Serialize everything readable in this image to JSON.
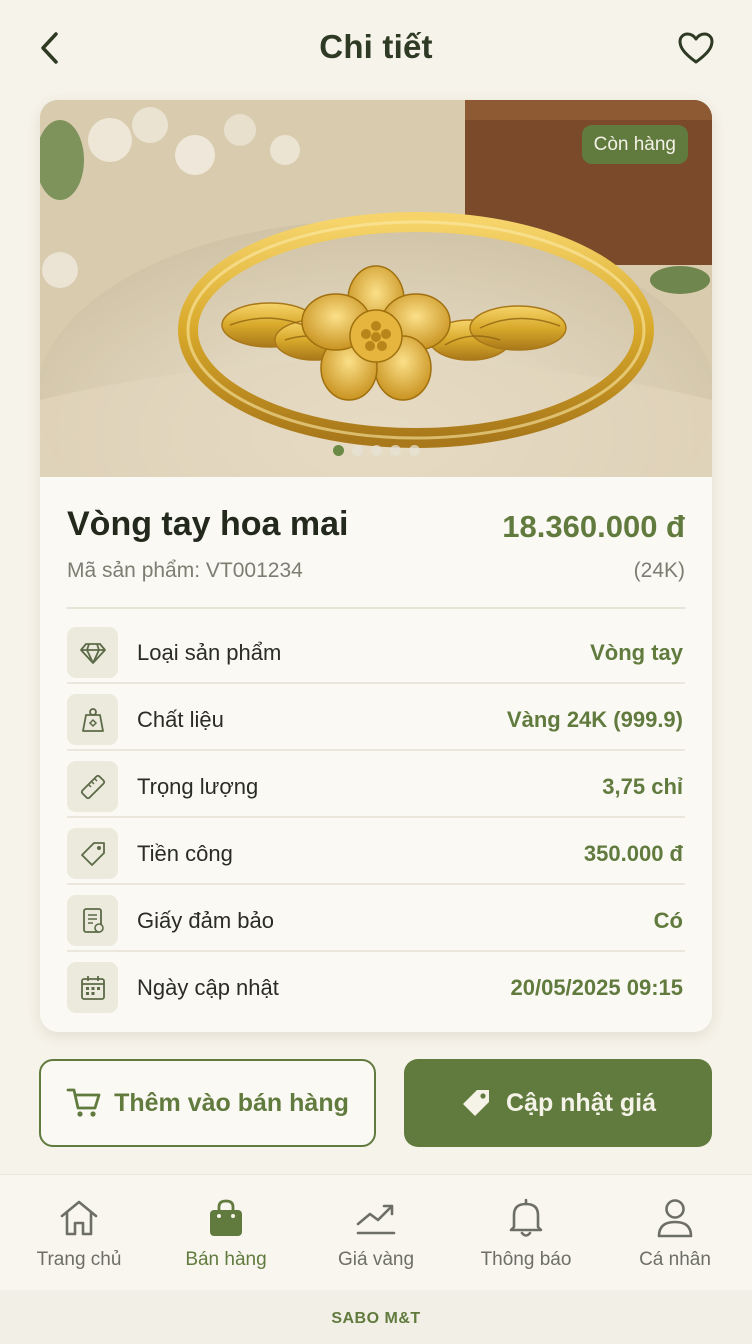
{
  "header": {
    "title": "Chi tiết",
    "back_icon": "chevron-left-icon",
    "favorite_icon": "heart-icon"
  },
  "product": {
    "stock_badge": "Còn hàng",
    "name": "Vòng tay hoa mai",
    "price": "18.360.000 đ",
    "code": "Mã sản phẩm: VT001234",
    "karat": "(24K)",
    "image_count": 5,
    "active_image": 1
  },
  "specs": [
    {
      "icon": "diamond-icon",
      "label": "Loại sản phẩm",
      "value": "Vòng tay"
    },
    {
      "icon": "weight-icon",
      "label": "Chất liệu",
      "value": "Vàng 24K (999.9)"
    },
    {
      "icon": "ruler-icon",
      "label": "Trọng lượng",
      "value": "3,75 chỉ"
    },
    {
      "icon": "tag-icon",
      "label": "Tiền công",
      "value": "350.000 đ"
    },
    {
      "icon": "certificate-icon",
      "label": "Giấy đảm bảo",
      "value": "Có"
    },
    {
      "icon": "calendar-icon",
      "label": "Ngày cập nhật",
      "value": "20/05/2025 09:15"
    }
  ],
  "actions": {
    "add_label": "Thêm vào bán hàng",
    "update_label": "Cập nhật giá"
  },
  "nav": [
    {
      "icon": "home-icon",
      "label": "Trang chủ",
      "active": false
    },
    {
      "icon": "shopping-bag-icon",
      "label": "Bán hàng",
      "active": true
    },
    {
      "icon": "trend-chart-icon",
      "label": "Giá vàng",
      "active": false
    },
    {
      "icon": "bell-icon",
      "label": "Thông báo",
      "active": false
    },
    {
      "icon": "user-icon",
      "label": "Cá nhân",
      "active": false
    }
  ],
  "footer": "SABO M&T",
  "colors": {
    "accent": "#617b3f",
    "background": "#f6f3ea",
    "card": "#fbf9f3"
  }
}
